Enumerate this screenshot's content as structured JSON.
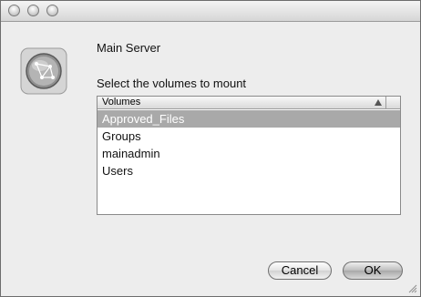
{
  "window": {
    "title": ""
  },
  "dialog": {
    "server_name": "Main Server",
    "prompt": "Select the volumes to mount",
    "icon": "network-server-globe-icon"
  },
  "volumes_list": {
    "header": "Volumes",
    "sort_indicator": "sort-ascending-icon",
    "items": [
      {
        "label": "Approved_Files",
        "selected": true
      },
      {
        "label": "Groups",
        "selected": false
      },
      {
        "label": "mainadmin",
        "selected": false
      },
      {
        "label": "Users",
        "selected": false
      }
    ]
  },
  "buttons": {
    "cancel_label": "Cancel",
    "ok_label": "OK"
  },
  "colors": {
    "selection": "#a9a9a9",
    "window_bg": "#ededed"
  }
}
